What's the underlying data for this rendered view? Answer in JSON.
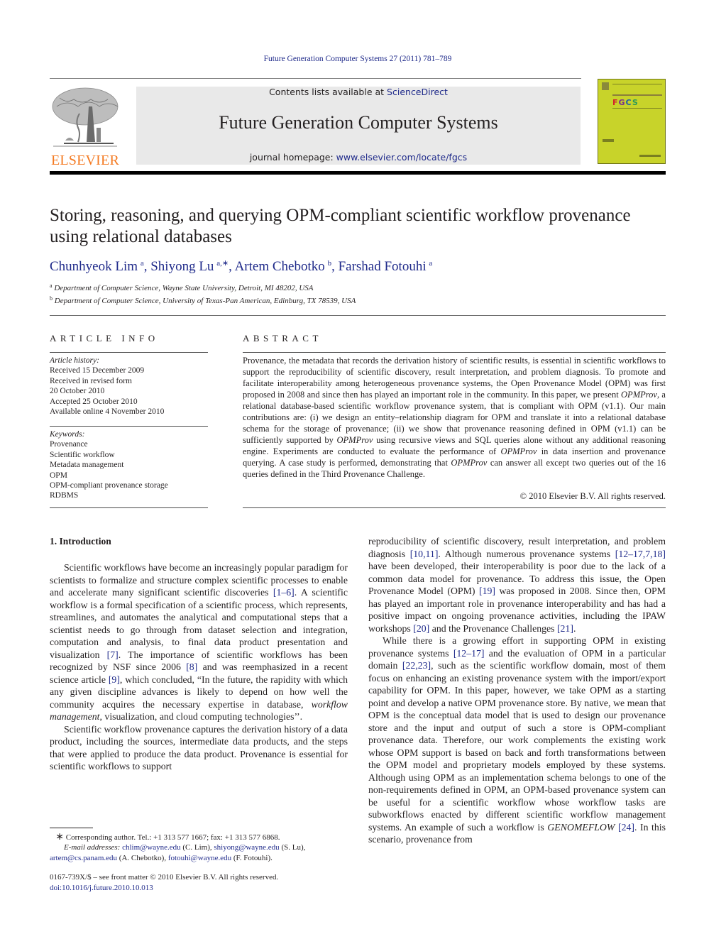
{
  "header": {
    "running_head": "Future Generation Computer Systems 27 (2011) 781–789",
    "contents_prefix": "Contents lists available at ",
    "contents_link": "ScienceDirect",
    "journal_title": "Future Generation Computer Systems",
    "homepage_prefix": "journal homepage: ",
    "homepage_link": "www.elsevier.com/locate/fgcs",
    "publisher_logo_text": "ELSEVIER",
    "cover_acronym": [
      "F",
      "G",
      "C",
      "S"
    ]
  },
  "colors": {
    "link": "#1f2a8a",
    "elsevier_orange": "#f47920",
    "header_box": "#e9e9e9",
    "cover": "#c8d32a"
  },
  "article": {
    "title_line1": "Storing, reasoning, and querying OPM-compliant scientific workflow provenance",
    "title_line2": "using relational databases",
    "authors": [
      {
        "name": "Chunhyeok Lim",
        "sup": "a"
      },
      {
        "name": "Shiyong Lu",
        "sup": "a,∗"
      },
      {
        "name": "Artem Chebotko",
        "sup": "b"
      },
      {
        "name": "Farshad Fotouhi",
        "sup": "a"
      }
    ],
    "affiliations": [
      {
        "mark": "a",
        "text": "Department of Computer Science, Wayne State University, Detroit, MI 48202, USA"
      },
      {
        "mark": "b",
        "text": "Department of Computer Science, University of Texas-Pan American, Edinburg, TX 78539, USA"
      }
    ]
  },
  "article_info": {
    "heading": "ARTICLE INFO",
    "history_label": "Article history:",
    "history": [
      "Received 15 December 2009",
      "Received in revised form",
      "20 October 2010",
      "Accepted 25 October 2010",
      "Available online 4 November 2010"
    ],
    "keywords_label": "Keywords:",
    "keywords": [
      "Provenance",
      "Scientific workflow",
      "Metadata management",
      "OPM",
      "OPM-compliant provenance storage",
      "RDBMS"
    ]
  },
  "abstract": {
    "heading": "ABSTRACT",
    "p1": "Provenance, the metadata that records the derivation history of scientific results, is essential in scientific workflows to support the reproducibility of scientific discovery, result interpretation, and problem diagnosis. To promote and facilitate interoperability among heterogeneous provenance systems, the Open Provenance Model (OPM) was first proposed in 2008 and since then has played an important role in the community. In this paper, we present ",
    "em1": "OPMProv",
    "p2": ", a relational database-based scientific workflow provenance system, that is compliant with OPM (v1.1). Our main contributions are: (i) we design an entity–relationship diagram for OPM and translate it into a relational database schema for the storage of provenance; (ii) we show that provenance reasoning defined in OPM (v1.1) can be sufficiently supported by ",
    "em2": "OPMProv",
    "p3": " using recursive views and SQL queries alone without any additional reasoning engine. Experiments are conducted to evaluate the performance of ",
    "em3": "OPMProv",
    "p4": " in data insertion and provenance querying. A case study is performed, demonstrating that ",
    "em4": "OPMProv",
    "p5": " can answer all except two queries out of the 16 queries defined in the Third Provenance Challenge.",
    "copyright": "© 2010 Elsevier B.V. All rights reserved."
  },
  "intro": {
    "heading": "1.  Introduction",
    "left": {
      "a1": "Scientific workflows have become an increasingly popular paradigm for scientists to formalize and structure complex scientific processes to enable and accelerate many significant scientific discoveries ",
      "r1": "[1–6]",
      "a2": ". A scientific workflow is a formal specification of a scientific process, which represents, streamlines, and automates the analytical and computational steps that a scientist needs to go through from dataset selection and integration, computation and analysis, to final data product presentation and visualization ",
      "r2": "[7]",
      "a3": ". The importance of scientific workflows has been recognized by NSF since 2006 ",
      "r3": "[8]",
      "a4": " and was reemphasized in a recent science article ",
      "r4": "[9]",
      "a5": ", which concluded, “In the future, the rapidity with which any given discipline advances is likely to depend on how well the community acquires the necessary expertise in database, ",
      "em": "workflow management",
      "a6": ", visualization, and cloud computing technologies’’.",
      "b1": "Scientific workflow provenance captures the derivation history of a data product, including the sources, intermediate data products, and the steps that were applied to produce the data product. Provenance is essential for scientific workflows to support"
    },
    "right": {
      "c1": "reproducibility of scientific discovery, result interpretation, and problem diagnosis ",
      "r1": "[10,11]",
      "c2": ". Although numerous provenance systems ",
      "r2": "[12–17,7,18]",
      "c3": " have been developed, their interoperability is poor due to the lack of a common data model for provenance. To address this issue, the Open Provenance Model (OPM) ",
      "r3": "[19]",
      "c4": " was proposed in 2008. Since then, OPM has played an important role in provenance interoperability and has had a positive impact on ongoing provenance activities, including the IPAW workshops ",
      "r4": "[20]",
      "c5": " and the Provenance Challenges ",
      "r5": "[21]",
      "c6": ".",
      "d1": "While there is a growing effort in supporting OPM in existing provenance systems ",
      "r6": "[12–17]",
      "d2": " and the evaluation of OPM in a particular domain ",
      "r7": "[22,23]",
      "d3": ", such as the scientific workflow domain, most of them focus on enhancing an existing provenance system with the import/export capability for OPM. In this paper, however, we take OPM as a starting point and develop a native OPM provenance store. By native, we mean that OPM is the conceptual data model that is used to design our provenance store and the input and output of such a store is OPM-compliant provenance data. Therefore, our work complements the existing work whose OPM support is based on back and forth transformations between the OPM model and proprietary models employed by these systems. Although using OPM as an implementation schema belongs to one of the non-requirements defined in OPM, an OPM-based provenance system can be useful for a scientific workflow whose workflow tasks are subworkflows enacted by different scientific workflow management systems. An example of such a workflow is ",
      "em": "GENOMEFLOW",
      "d4": " ",
      "r8": "[24]",
      "d5": ". In this scenario, provenance from"
    }
  },
  "footnotes": {
    "star": "∗",
    "corresponding": "Corresponding author. Tel.: +1 313 577 1667; fax: +1 313 577 6868.",
    "email_label": "E-mail addresses:",
    "emails": [
      {
        "addr": "chlim@wayne.edu",
        "who": " (C. Lim), "
      },
      {
        "addr": "shiyong@wayne.edu",
        "who": " (S. Lu),"
      },
      {
        "addr": "artem@cs.panam.edu",
        "who": " (A. Chebotko), "
      },
      {
        "addr": "fotouhi@wayne.edu",
        "who": " (F. Fotouhi)."
      }
    ],
    "issn": "0167-739X/$ – see front matter © 2010 Elsevier B.V. All rights reserved.",
    "doi": "doi:10.1016/j.future.2010.10.013"
  }
}
